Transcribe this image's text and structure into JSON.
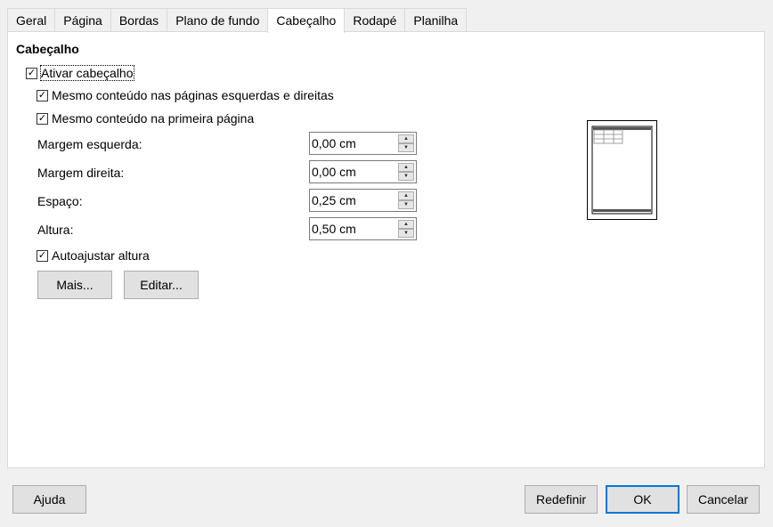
{
  "tabs": [
    {
      "label": "Geral"
    },
    {
      "label": "Página"
    },
    {
      "label": "Bordas"
    },
    {
      "label": "Plano de fundo"
    },
    {
      "label": "Cabeçalho"
    },
    {
      "label": "Rodapé"
    },
    {
      "label": "Planilha"
    }
  ],
  "active_tab": "Cabeçalho",
  "section": {
    "title": "Cabeçalho"
  },
  "checkboxes": {
    "enable": {
      "label": "Ativar cabeçalho",
      "checked": true
    },
    "same_lr": {
      "label": "Mesmo conteúdo nas páginas esquerdas e direitas",
      "checked": true
    },
    "same_first": {
      "label": "Mesmo conteúdo na primeira página",
      "checked": true
    },
    "autofit": {
      "label": "Autoajustar altura",
      "checked": true
    }
  },
  "fields": {
    "left_margin": {
      "label": "Margem esquerda:",
      "value": "0,00 cm"
    },
    "right_margin": {
      "label": "Margem direita:",
      "value": "0,00 cm"
    },
    "spacing": {
      "label": "Espaço:",
      "value": "0,25 cm"
    },
    "height": {
      "label": "Altura:",
      "value": "0,50 cm"
    }
  },
  "buttons": {
    "more": "Mais...",
    "edit": "Editar...",
    "help": "Ajuda",
    "reset": "Redefinir",
    "ok": "OK",
    "cancel": "Cancelar"
  },
  "check_glyph": "✓",
  "spin_up_glyph": "▲",
  "spin_down_glyph": "▼",
  "colors": {
    "accent": "#0078d7",
    "panel_bg": "#ffffff",
    "dialog_bg": "#f0f0f0"
  }
}
